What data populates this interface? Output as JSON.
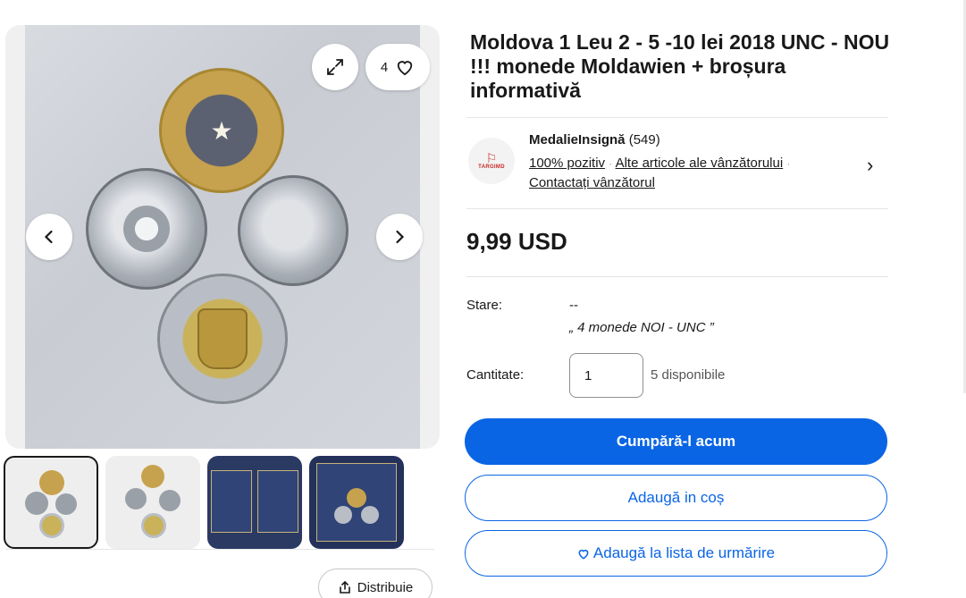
{
  "gallery": {
    "watch_count": "4",
    "thumbnails": [
      "thumb-1",
      "thumb-2",
      "thumb-3",
      "thumb-4"
    ],
    "share_label": "Distribuie"
  },
  "listing": {
    "title": "Moldova 1 Leu 2 - 5 -10 lei 2018 UNC - NOU !!! monede Moldawien + broșura informativă",
    "price": "9,99 USD"
  },
  "seller": {
    "logo_text": "TARGIMD",
    "name": "MedalieInsignă",
    "feedback_count": "(549)",
    "positive": "100% pozitiv",
    "other_items": "Alte articole ale vânzătorului",
    "contact": "Contactați vânzătorul"
  },
  "details": {
    "condition_label": "Stare:",
    "condition_value": "--",
    "condition_desc": "„ 4 monede NOI - UNC ”",
    "quantity_label": "Cantitate:",
    "quantity_value": "1",
    "available": "5 disponibile"
  },
  "actions": {
    "buy_now": "Cumpără-l acum",
    "add_to_cart": "Adaugă in coș",
    "watchlist": "Adaugă la lista de urmărire"
  },
  "colors": {
    "primary": "#0a65e5",
    "text": "#191919"
  }
}
